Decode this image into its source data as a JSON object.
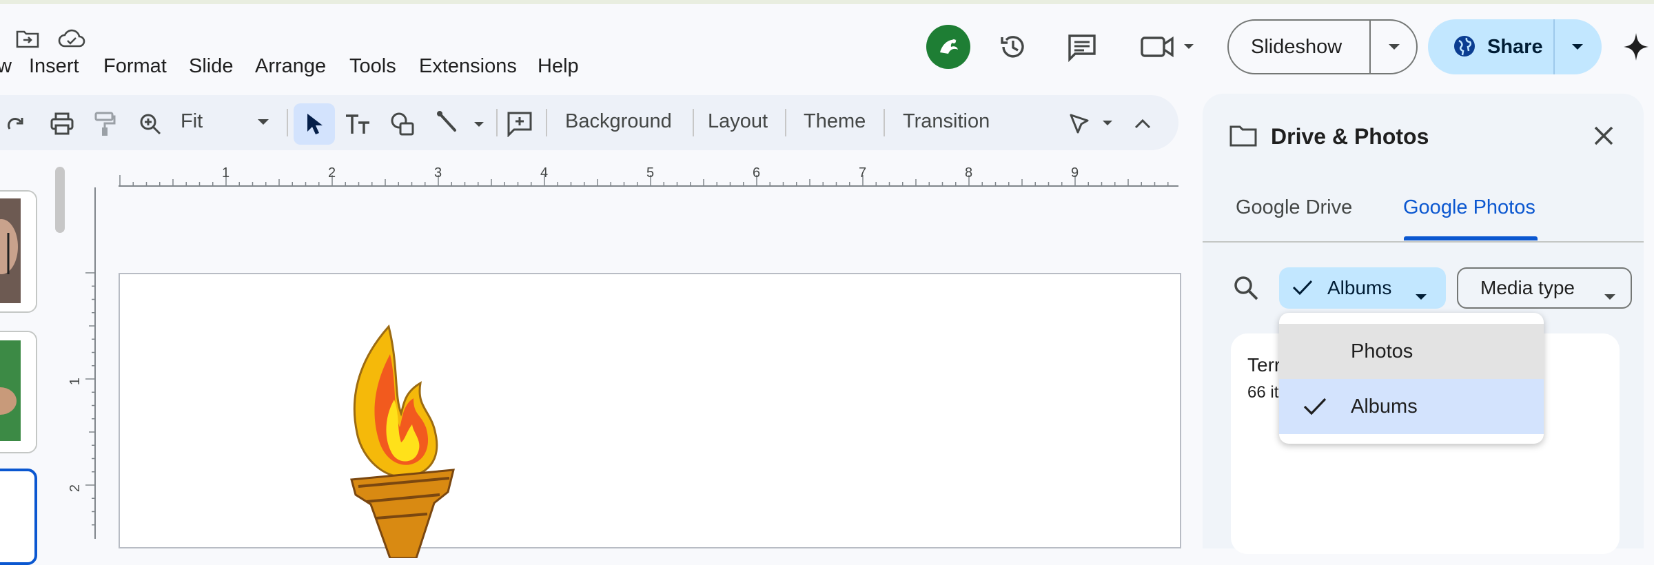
{
  "menu": [
    "w",
    "Insert",
    "Format",
    "Slide",
    "Arrange",
    "Tools",
    "Extensions",
    "Help"
  ],
  "header": {
    "slideshow_label": "Slideshow",
    "share_label": "Share"
  },
  "toolbar": {
    "zoom_value": "Fit",
    "background_label": "Background",
    "layout_label": "Layout",
    "theme_label": "Theme",
    "transition_label": "Transition"
  },
  "ruler": {
    "h_ticks": [
      "1",
      "2",
      "3",
      "4",
      "5",
      "6",
      "7",
      "8",
      "9"
    ],
    "v_ticks": [
      "1",
      "2"
    ]
  },
  "panel": {
    "title": "Drive & Photos",
    "tabs": [
      {
        "label": "Google Drive",
        "active": false
      },
      {
        "label": "Google Photos",
        "active": true
      }
    ],
    "filter_albums_label": "Albums",
    "filter_media_label": "Media type",
    "album_card": {
      "title_partial": "Terr",
      "count_partial": "66 it"
    },
    "dropdown": {
      "options": [
        {
          "label": "Photos",
          "selected": false
        },
        {
          "label": "Albums",
          "selected": true
        }
      ]
    }
  },
  "colors": {
    "accent_blue": "#0b57d0",
    "share_bg": "#c2e7ff",
    "avatar_green": "#1e7e34",
    "panel_bg": "#f0f4f9",
    "selected_option": "#d3e3fd",
    "hover_option": "#e3e3e3"
  }
}
